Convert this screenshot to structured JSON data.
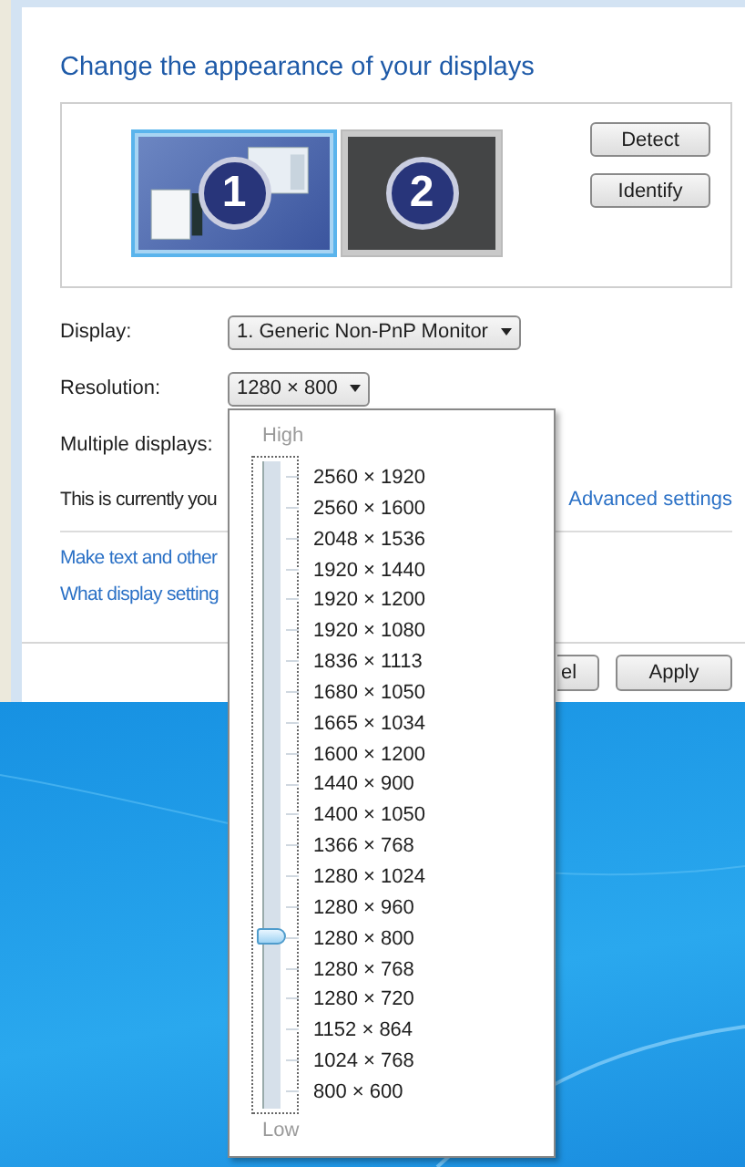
{
  "heading": "Change the appearance of your displays",
  "monitors": [
    {
      "number": "1",
      "selected": true
    },
    {
      "number": "2",
      "selected": false
    }
  ],
  "side_buttons": [
    "Detect",
    "Identify"
  ],
  "fields": [
    {
      "label": "Display:",
      "value": "1. Generic Non-PnP Monitor"
    },
    {
      "label": "Resolution:",
      "value": "1280 × 800"
    },
    {
      "label": "Multiple displays:"
    }
  ],
  "status_text": "This is currently you",
  "advanced_link": "Advanced settings",
  "links": [
    "Make text and other",
    "What display setting"
  ],
  "footer_buttons": [
    "el",
    "Apply"
  ],
  "resolution_popup": {
    "high_label": "High",
    "low_label": "Low",
    "level": 0.25,
    "options": [
      "2560 × 1920",
      "2560 × 1600",
      "2048 × 1536",
      "1920 × 1440",
      "1920 × 1200",
      "1920 × 1080",
      "1836 × 1113",
      "1680 × 1050",
      "1665 × 1034",
      "1600 × 1200",
      "1440 × 900",
      "1400 × 1050",
      "1366 × 768",
      "1280 × 1024",
      "1280 × 960",
      "1280 × 800",
      "1280 × 768",
      "1280 × 720",
      "1152 × 864",
      "1024 × 768",
      "800 × 600"
    ]
  }
}
